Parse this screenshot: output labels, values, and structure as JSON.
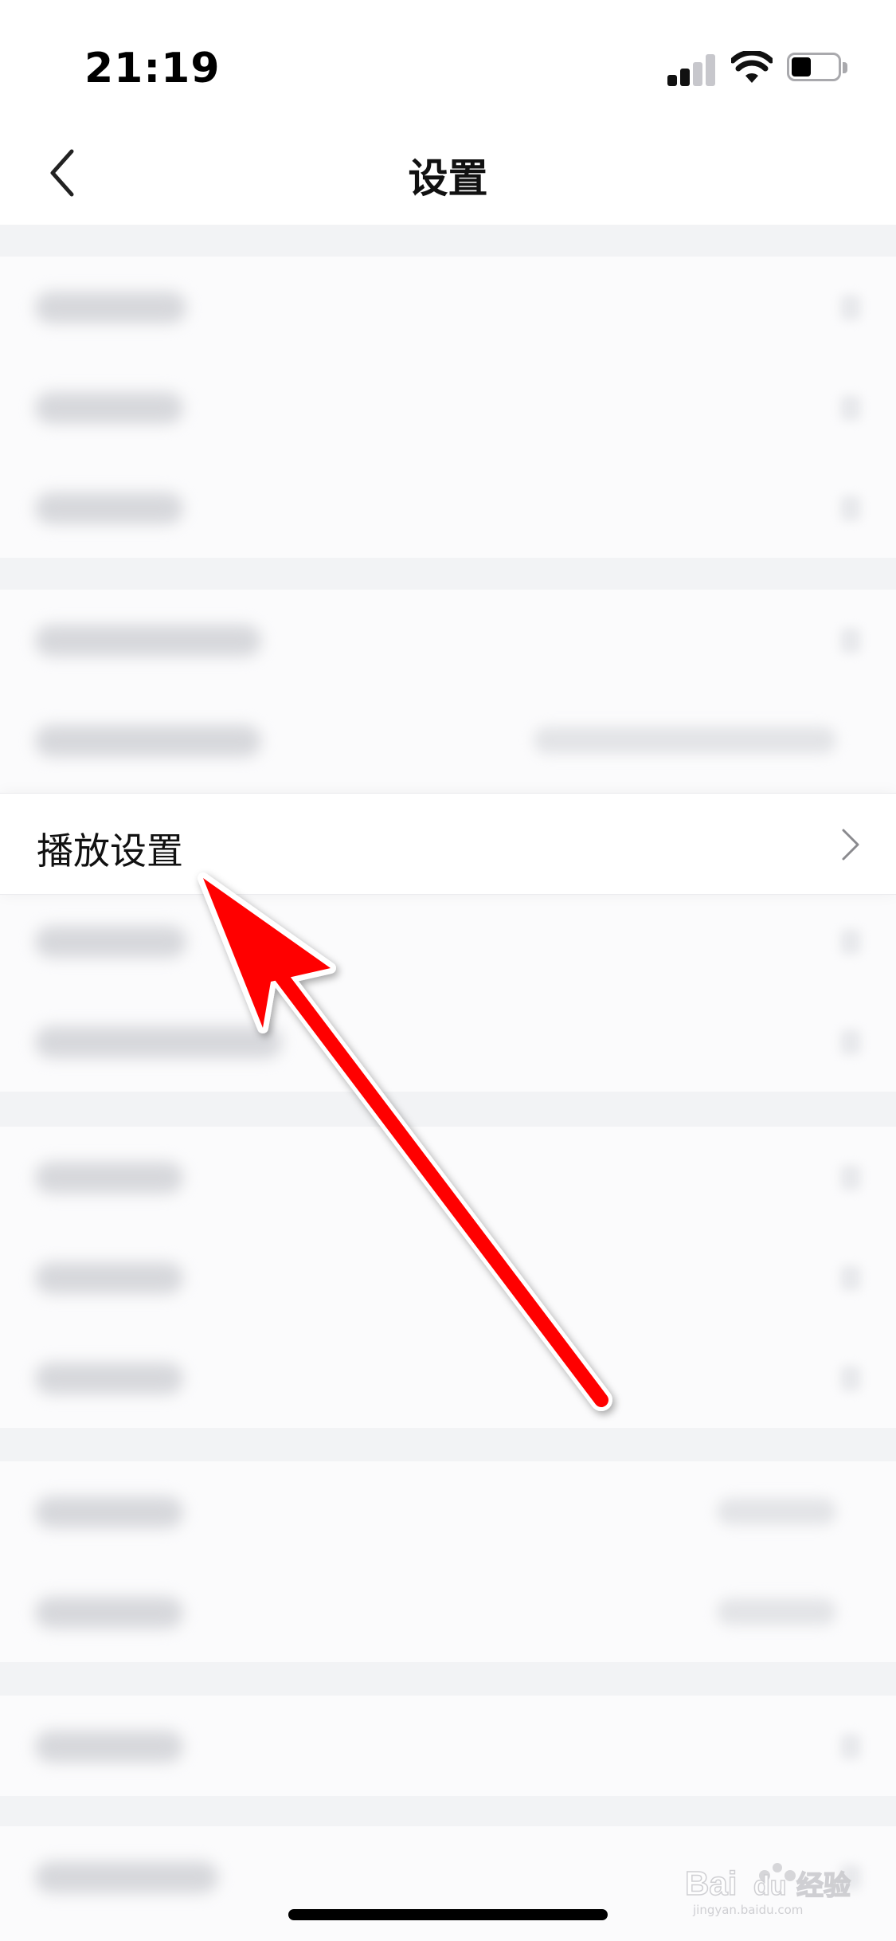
{
  "status_bar": {
    "time": "21:19",
    "icons": [
      "signal-icon",
      "wifi-icon",
      "battery-icon"
    ]
  },
  "nav": {
    "title": "设置",
    "back_icon": "chevron-left-icon"
  },
  "settings": {
    "highlighted_item": {
      "label": "播放设置",
      "icon": "chevron-right-icon"
    },
    "blurred_items_note": "obscured"
  },
  "annotation": {
    "arrow_color": "#ff0000",
    "target": "播放设置"
  },
  "watermark": {
    "brand_text": "Baidu经验",
    "url_text": "jingyan.baidu.com"
  }
}
